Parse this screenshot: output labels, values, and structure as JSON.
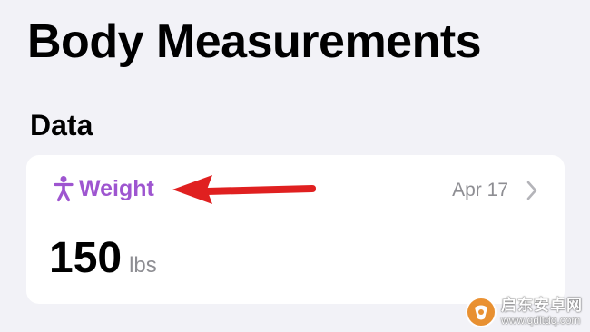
{
  "page": {
    "title": "Body Measurements",
    "section_title": "Data"
  },
  "card": {
    "label": "Weight",
    "date": "Apr 17",
    "value": "150",
    "unit": "lbs",
    "icon": "figure-standing-icon",
    "accent_color": "#9e55d0",
    "chevron_icon": "chevron-right-icon"
  },
  "annotation": {
    "icon": "red-arrow-annotation",
    "color": "#e02020"
  },
  "watermark": {
    "title": "启东安卓网",
    "url": "www.qdltdq.com"
  },
  "colors": {
    "background": "#f2f2f7",
    "card_background": "#ffffff",
    "secondary_text": "#8e8e93"
  }
}
